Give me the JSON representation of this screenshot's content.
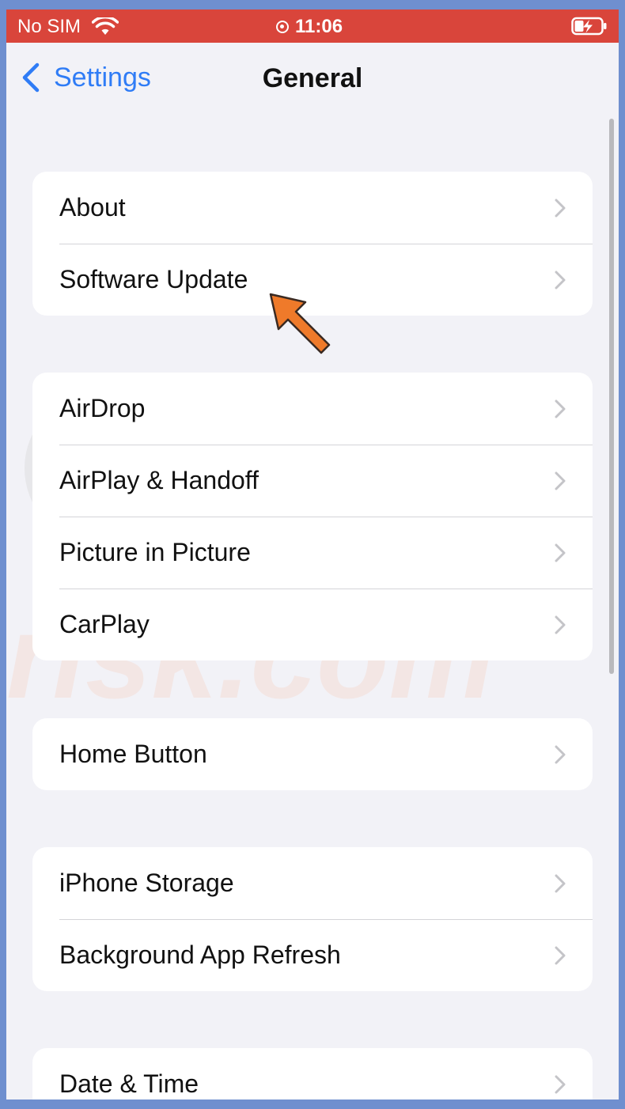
{
  "status_bar": {
    "carrier": "No SIM",
    "time": "11:06",
    "background": "#d9453b"
  },
  "nav": {
    "back_label": "Settings",
    "title": "General",
    "accent": "#2f7cf6"
  },
  "groups": [
    {
      "items": [
        {
          "label": "About"
        },
        {
          "label": "Software Update"
        }
      ]
    },
    {
      "items": [
        {
          "label": "AirDrop"
        },
        {
          "label": "AirPlay & Handoff"
        },
        {
          "label": "Picture in Picture"
        },
        {
          "label": "CarPlay"
        }
      ]
    },
    {
      "items": [
        {
          "label": "Home Button"
        }
      ]
    },
    {
      "items": [
        {
          "label": "iPhone Storage"
        },
        {
          "label": "Background App Refresh"
        }
      ]
    },
    {
      "items": [
        {
          "label": "Date & Time"
        }
      ]
    }
  ],
  "annotation": {
    "arrow_color": "#ef7a2a"
  },
  "watermark": {
    "text_top": "PC",
    "text_bottom": "risk.com"
  }
}
